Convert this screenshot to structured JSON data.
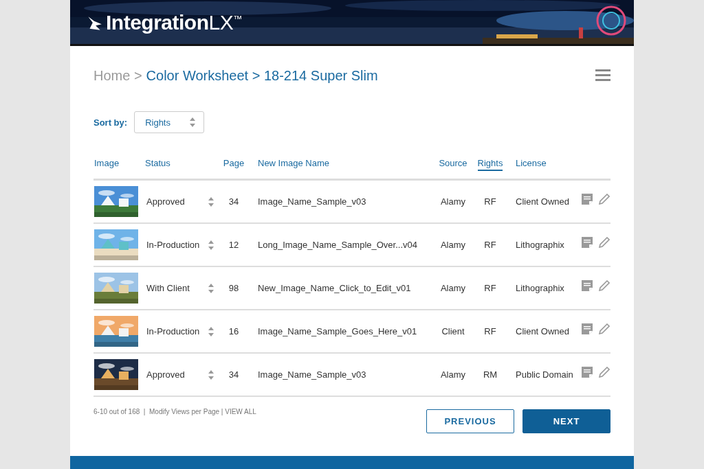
{
  "header": {
    "logo": "**Integration**LX$^{™}$"
  },
  "breadcrumb": {
    "home": "Home >",
    "path": "Color Worksheet > 18-214 Super Slim"
  },
  "sort": {
    "label": "Sort by:",
    "value": "Rights"
  },
  "table": {
    "columns": [
      {
        "label": "Image",
        "selected": false
      },
      {
        "label": "Status",
        "selected": false
      },
      {
        "label": "Page",
        "selected": false
      },
      {
        "label": "New Image Name",
        "selected": false
      },
      {
        "label": "Source",
        "selected": false
      },
      {
        "label": "Rights",
        "selected": true
      },
      {
        "label": "License",
        "selected": false
      }
    ],
    "rows": [
      {
        "status": "Approved",
        "page": "34",
        "name": "Image_Name_Sample_v03",
        "source": "Alamy",
        "rights": "RF",
        "license": "Client Owned"
      },
      {
        "status": "In-Production",
        "page": "12",
        "name": "Long_Image_Name_Sample_Over...v04",
        "source": "Alamy",
        "rights": "RF",
        "license": "Lithographix"
      },
      {
        "status": "With Client",
        "page": "98",
        "name": "New_Image_Name_Click_to_Edit_v01",
        "source": "Alamy",
        "rights": "RF",
        "license": "Lithographix"
      },
      {
        "status": "In-Production",
        "page": "16",
        "name": "Image_Name_Sample_Goes_Here_v01",
        "source": "Client",
        "rights": "RF",
        "license": "Client Owned"
      },
      {
        "status": "Approved",
        "page": "34",
        "name": "Image_Name_Sample_v03",
        "source": "Alamy",
        "rights": "RM",
        "license": "Public Domain"
      }
    ]
  },
  "footer": {
    "info": "6-10 out of 168  |  Modify Views per Page | VIEW ALL",
    "previous": "PREVIOUS",
    "next": "NEXT"
  }
}
